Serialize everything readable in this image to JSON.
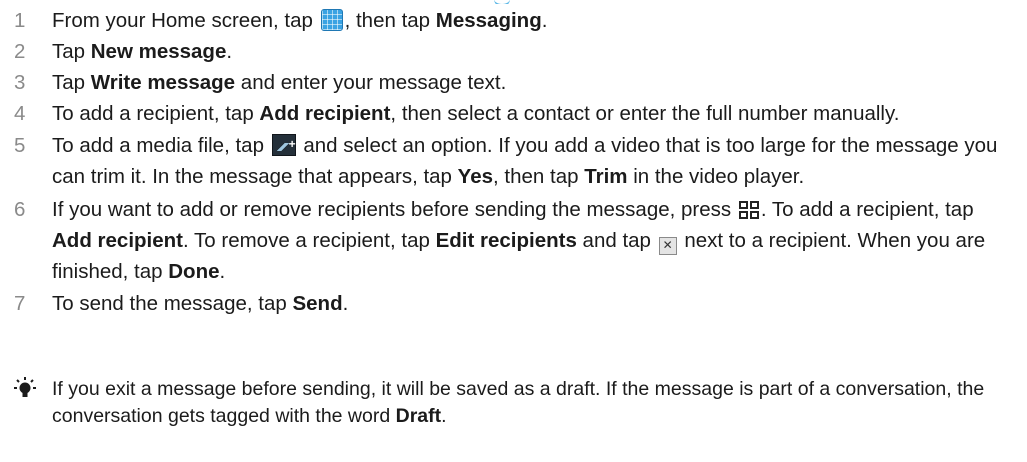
{
  "steps": [
    {
      "num": "1",
      "a": "From your Home screen, tap ",
      "b": ", then tap ",
      "c": "Messaging",
      "d": "."
    },
    {
      "num": "2",
      "a": "Tap ",
      "b": "New message",
      "c": "."
    },
    {
      "num": "3",
      "a": "Tap ",
      "b": "Write message",
      "c": " and enter your message text."
    },
    {
      "num": "4",
      "a": "To add a recipient, tap ",
      "b": "Add recipient",
      "c": ", then select a contact or enter the full number manually."
    },
    {
      "num": "5",
      "a": "To add a media file, tap ",
      "b": " and select an option. If you add a video that is too large for the message you can trim it. In the message that appears, tap ",
      "c": "Yes",
      "d": ", then tap ",
      "e": "Trim",
      "f": " in the video player."
    },
    {
      "num": "6",
      "a": "If you want to add or remove recipients before sending the message, press ",
      "b": ". To add a recipient, tap ",
      "c": "Add recipient",
      "d": ". To remove a recipient, tap ",
      "e": "Edit recipients",
      "f": " and tap ",
      "g": " next to a recipient. When you are finished, tap ",
      "h": "Done",
      "i": "."
    },
    {
      "num": "7",
      "a": "To send the message, tap ",
      "b": "Send",
      "c": "."
    }
  ],
  "tip": {
    "a": "If you exit a message before sending, it will be saved as a draft. If the message is part of a conversation, the conversation gets tagged with the word ",
    "b": "Draft",
    "c": "."
  },
  "icons": {
    "apps": "apps-grid-icon",
    "media": "attach-media-icon",
    "menu": "menu-key-icon",
    "remove": "remove-recipient-icon",
    "tip": "tip-lightbulb-icon"
  },
  "colors": {
    "accent": "#3aa3e3",
    "step_number": "#8a8a8a",
    "text": "#1b1b1b"
  }
}
